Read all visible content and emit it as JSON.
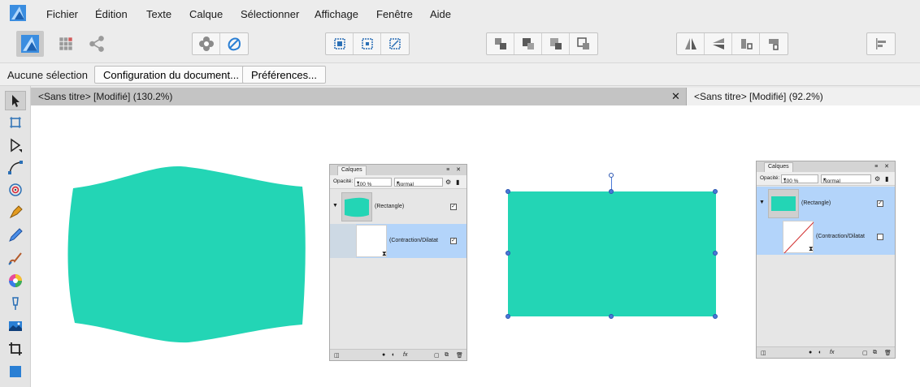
{
  "menu": {
    "items": [
      "Fichier",
      "Édition",
      "Texte",
      "Calque",
      "Sélectionner",
      "Affichage",
      "Fenêtre",
      "Aide"
    ]
  },
  "toolbar": {
    "personas": [
      "designer-persona-icon",
      "pixel-persona-icon",
      "export-persona-icon"
    ],
    "groups": [
      [
        "mesh-warp-icon",
        "shape-builder-icon"
      ],
      [
        "snap-to-pixel-icon",
        "snap-to-grid-icon",
        "transform-icon"
      ],
      [
        "bring-to-front-icon",
        "bring-forward-icon",
        "send-backward-icon",
        "send-to-back-icon"
      ],
      [
        "flip-horizontal-icon",
        "flip-vertical-icon",
        "rotate-left-icon",
        "rotate-right-icon"
      ],
      [
        "align-icon"
      ]
    ]
  },
  "context": {
    "selection_label": "Aucune sélection",
    "doc_setup_button": "Configuration du document...",
    "prefs_button": "Préférences..."
  },
  "tabs": [
    {
      "label": "<Sans titre> [Modifié] (130.2%)",
      "active": true
    },
    {
      "label": "<Sans titre> [Modifié] (92.2%)",
      "active": false
    }
  ],
  "tools": [
    "move-tool-icon",
    "artboard-tool-icon",
    "node-tool-icon",
    "corner-tool-icon",
    "target-icon",
    "pen-tool-icon",
    "pencil-tool-icon",
    "vector-brush-icon",
    "color-picker-icon",
    "fill-tool-icon",
    "place-image-icon",
    "crop-tool-icon",
    "rectangle-tool-icon"
  ],
  "colors": {
    "shape_fill": "#23d5b5",
    "selection_blue": "#b3d4fa",
    "handle": "#4a79d8"
  },
  "layers_panel_left": {
    "title": "Calques",
    "opacity_label": "Opacité:",
    "opacity_value": "100 %",
    "blend_mode": "Normal",
    "layer_1": "(Rectangle)",
    "layer_2": "(Contraction/Dilatat",
    "fx_label": "fx"
  },
  "layers_panel_right": {
    "title": "Calques",
    "opacity_label": "Opacité:",
    "opacity_value": "100 %",
    "blend_mode": "Normal",
    "layer_1": "(Rectangle)",
    "layer_2": "(Contraction/Dilatat",
    "fx_label": "fx"
  }
}
